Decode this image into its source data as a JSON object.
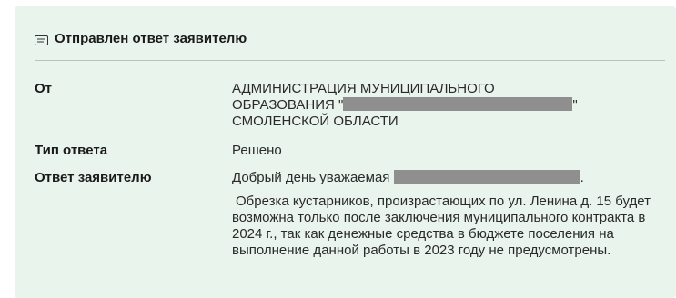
{
  "header": {
    "icon": "message-icon",
    "title": "Отправлен ответ заявителю"
  },
  "rows": {
    "from": {
      "label": "От",
      "line1": "АДМИНИСТРАЦИЯ МУНИЦИПАЛЬНОГО",
      "line2_prefix": "ОБРАЗОВАНИЯ \"",
      "line2_suffix": "\"",
      "line3": "СМОЛЕНСКОЙ ОБЛАСТИ"
    },
    "type": {
      "label": "Тип ответа",
      "value": "Решено"
    },
    "answer": {
      "label": "Ответ заявителю",
      "greeting_prefix": "Добрый день уважаемая",
      "greeting_suffix": ".",
      "body": "Обрезка кустарников, произрастающих по ул. Ленина д. 15 будет возможна только после заключения муниципального контракта в 2024 г., так как денежные средства в бюджете поселения на выполнение данной работы в 2023 году не предусмотрены."
    }
  },
  "colors": {
    "panel_bg": "#e9f4ec",
    "redaction": "#8f8f8f",
    "divider": "#b9c4bc"
  }
}
